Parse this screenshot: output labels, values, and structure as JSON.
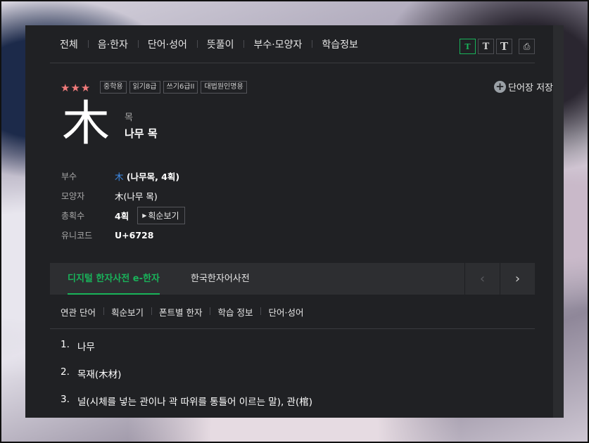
{
  "topnav": {
    "items": [
      "전체",
      "음·한자",
      "단어·성어",
      "뜻풀이",
      "부수·모양자",
      "학습정보"
    ]
  },
  "font_tools": {
    "glyphs": [
      "T",
      "T",
      "T",
      "⎙"
    ]
  },
  "header": {
    "stars": "★★★",
    "badges": [
      "중학용",
      "읽기8급",
      "쓰기6급II",
      "대법원인명용"
    ],
    "save_label": "단어장 저장",
    "hanja": "木",
    "sound_label": "목",
    "meaning": "나무 목"
  },
  "info": {
    "radical_label": "부수",
    "radical_char": "木",
    "radical_desc": " (나무목, 4획)",
    "shape_label": "모양자",
    "shape_value": "木(나무 목)",
    "strokes_label": "총획수",
    "strokes_value": "4획",
    "stroke_button": "획순보기",
    "unicode_label": "유니코드",
    "unicode_value": "U+6728"
  },
  "tabs": {
    "dict1": "디지털 한자사전 e-한자",
    "dict2": "한국한자어사전",
    "prev_arrow": "‹",
    "next_arrow": "›"
  },
  "subnav": {
    "items": [
      "연관 단어",
      "획순보기",
      "폰트별 한자",
      "학습 정보",
      "단어·성어"
    ]
  },
  "definitions": [
    {
      "num": "1.",
      "text": "나무"
    },
    {
      "num": "2.",
      "text": "목재(木材)"
    },
    {
      "num": "3.",
      "text": "널(시체를 넣는 관이나 곽 따위를 통틀어 이르는 말), 관(棺)"
    }
  ],
  "colors": {
    "accent": "#19b35a",
    "stars": "#f07a7a",
    "link": "#3d8be8",
    "panel": "#202124"
  }
}
